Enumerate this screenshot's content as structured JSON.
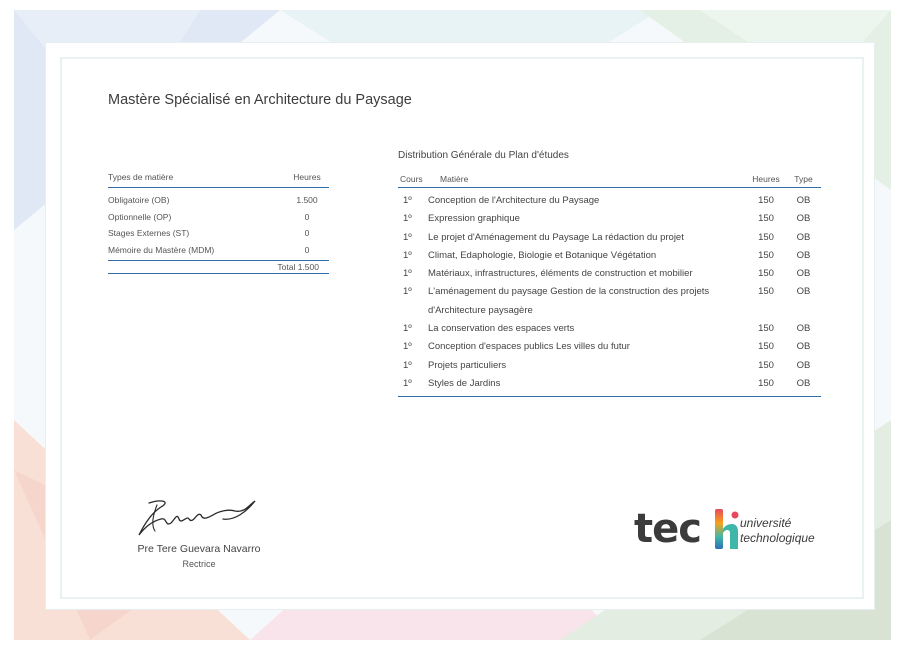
{
  "certificate": {
    "title": "Mastère Spécialisé en Architecture du Paysage"
  },
  "summary_table": {
    "header_type": "Types de matière",
    "header_hours": "Heures",
    "rows": [
      {
        "type": "Obligatoire (OB)",
        "hours": "1.500"
      },
      {
        "type": "Optionnelle (OP)",
        "hours": "0"
      },
      {
        "type": "Stages Externes (ST)",
        "hours": "0"
      },
      {
        "type": "Mémoire du Mastère (MDM)",
        "hours": "0"
      }
    ],
    "total": "Total 1.500"
  },
  "plan": {
    "title": "Distribution Générale du Plan d'études",
    "headers": {
      "course": "Cours",
      "subject": "Matière",
      "hours": "Heures",
      "type": "Type"
    },
    "rows": [
      {
        "course": "1º",
        "subject": "Conception de l'Architecture du Paysage",
        "hours": "150",
        "type": "OB"
      },
      {
        "course": "1º",
        "subject": "Expression graphique",
        "hours": "150",
        "type": "OB"
      },
      {
        "course": "1º",
        "subject": "Le projet d'Aménagement du Paysage La rédaction du projet",
        "hours": "150",
        "type": "OB"
      },
      {
        "course": "1º",
        "subject": "Climat, Edaphologie, Biologie et Botanique Végétation",
        "hours": "150",
        "type": "OB"
      },
      {
        "course": "1º",
        "subject": "Matériaux, infrastructures, éléments de construction et mobilier",
        "hours": "150",
        "type": "OB"
      },
      {
        "course": "1º",
        "subject": "L'aménagement du paysage Gestion de la construction des projets d'Architecture paysagère",
        "hours": "150",
        "type": "OB"
      },
      {
        "course": "1º",
        "subject": "La conservation des espaces verts",
        "hours": "150",
        "type": "OB"
      },
      {
        "course": "1º",
        "subject": "Conception d'espaces publics Les villes du futur",
        "hours": "150",
        "type": "OB"
      },
      {
        "course": "1º",
        "subject": "Projets particuliers",
        "hours": "150",
        "type": "OB"
      },
      {
        "course": "1º",
        "subject": "Styles de Jardins",
        "hours": "150",
        "type": "OB"
      }
    ]
  },
  "signature": {
    "name": "Pre Tere Guevara Navarro",
    "role": "Rectrice"
  },
  "logo": {
    "word": "tec",
    "line1": "université",
    "line2": "technologique",
    "colors": [
      "#e8475f",
      "#f7a21b",
      "#3fb7a8",
      "#2d6fb7"
    ]
  },
  "colors": {
    "accent_rule": "#2f6da8",
    "text": "#444444"
  }
}
